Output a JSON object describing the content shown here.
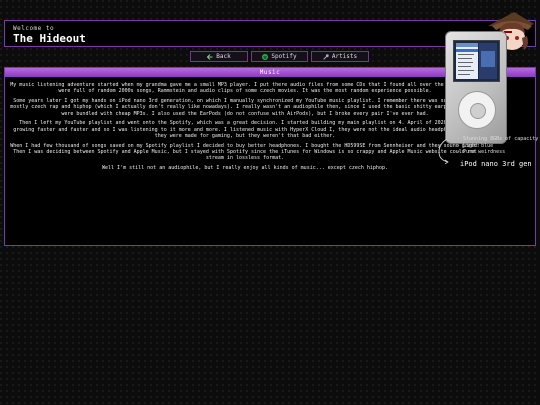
{
  "header": {
    "welcome": "Welcome to",
    "title": "The Hideout"
  },
  "nav": {
    "back": "Back",
    "spotify": "Spotify",
    "artists": "Artists"
  },
  "section": {
    "title": "Music",
    "paragraphs": [
      "My music listening adventure started when my grandma gave me a small MP3 player. I put there audio files from some CDs that I found all over the house, they were full of random 2000s songs, Rammstein and audio clips of some czech movies. It was the most random experience possible.",
      "Some years later I got my hands on iPod nano 3rd generation, on which I manually synchronized my YouTube music playlist. I remember there was some pop and mostly czech rap and hiphop (which I actually don't really like nowadays). I really wasn't an audiophile then, since I used the basic shitty earphones, that were bundled with cheap MP3s. I also used the EarPods (do not confuse with AirPods), but I broke every pair I've ever had.",
      "Then I left my YouTube playlist and went onto the Spotify, which was a great decision. I started building my main playlist on 4. April of 2020. It was growing faster and faster and so I was listening to it more and more. I listened music with HyperX Cloud I, they were not the ideal audio headphones since they were made for gaming, but they weren't that bad either.",
      "When I had few thousand of songs saved on my Spotify playlist I decided to buy better headphones. I bought the HD599SE from Sennheiser and they sound great! Then I was deciding between Spotify and Apple Music, but I stayed with Spotify since the iTunes for Windows is so crappy and Apple Music website could not stream in lossless format.",
      "Well I'm still not an audiophile, but I really enjoy all kinds of music... except czech hiphop."
    ],
    "ipod_features": [
      "- Stunning 8GBs of capacity",
      "- Light blue",
      "- Pure weirdness"
    ],
    "ipod_label": "iPod nano 3rd gen"
  },
  "colors": {
    "accent": "#8a3bbf",
    "border": "#7a3aa8",
    "background": "#0c0c0c",
    "spotify_green": "#1db954"
  },
  "icons": {
    "back": "back-arrow-icon",
    "spotify": "spotify-icon",
    "artists": "microphone-icon"
  }
}
